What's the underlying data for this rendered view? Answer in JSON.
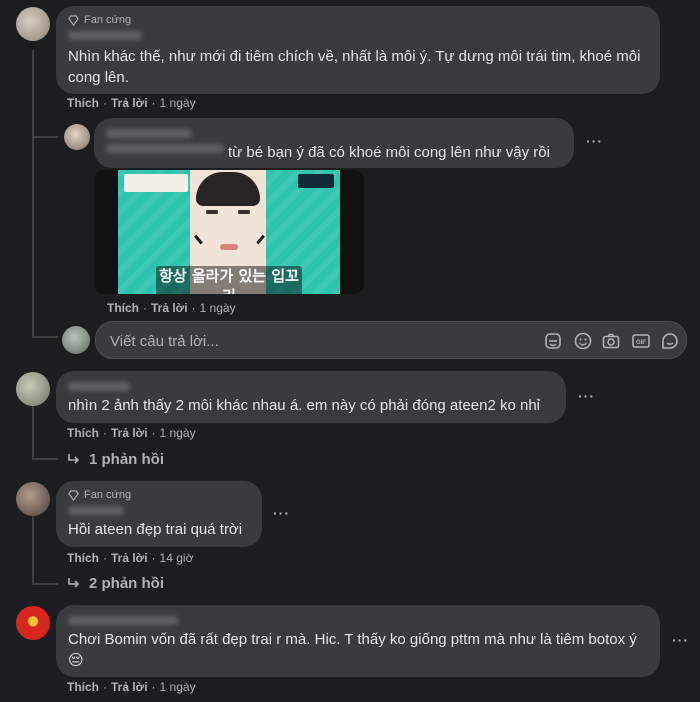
{
  "comments": [
    {
      "badge": "Fan cứng",
      "text": "Nhìn khác thế, như mới đi tiêm chích về, nhất là môi ý. Tự dưng môi trái tim, khoé môi cong lên.",
      "like": "Thích",
      "reply": "Trả lời",
      "time": "1 ngày"
    },
    {
      "text": "từ bé bạn ý đã có khoé môi cong lên như vậy rồi",
      "like": "Thích",
      "reply": "Trả lời",
      "time": "1 ngày",
      "image_caption": "항상 올라가 있는 입꼬리"
    },
    {
      "text": "nhìn 2 ảnh thấy 2 môi khác nhau á. em này có phải đóng ateen2 ko nhỉ",
      "like": "Thích",
      "reply": "Trả lời",
      "time": "1 ngày",
      "replies": "1 phản hồi"
    },
    {
      "badge": "Fan cứng",
      "text": "Hồi ateen đẹp trai quá trời",
      "like": "Thích",
      "reply": "Trả lời",
      "time": "14 giờ",
      "replies": "2 phản hồi"
    },
    {
      "text": "Chơi Bomin vốn đã rất đẹp trai r mà. Hic. T thấy ko giống pttm mà như là tiêm botox ý 😔",
      "like": "Thích",
      "reply": "Trả lời",
      "time": "1 ngày"
    }
  ],
  "reply_box": {
    "placeholder": "Viết câu trả lời..."
  },
  "separator": "·",
  "more": "···",
  "icons": [
    "diamond-icon",
    "sticker-icon",
    "emoji-icon",
    "camera-icon",
    "gif-icon",
    "avatar-sticker-icon",
    "reply-arrow-icon",
    "more-dots-icon"
  ],
  "colors": {
    "background": "#1c1d1f",
    "bubble": "#3a3b3c",
    "text": "#e4e6eb",
    "muted": "#b0b3b8"
  }
}
